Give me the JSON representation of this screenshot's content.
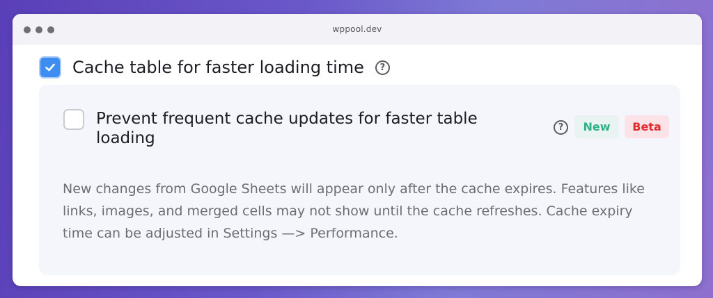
{
  "window": {
    "url": "wppool.dev"
  },
  "main_option": {
    "label": "Cache table for faster loading time",
    "checked": true,
    "help_icon": "question-circle-icon"
  },
  "sub_option": {
    "label": "Prevent frequent cache updates for faster table loading",
    "checked": false,
    "help_icon": "question-circle-icon",
    "badges": {
      "new": "New",
      "beta": "Beta"
    },
    "description": "New changes from Google Sheets will appear only after the cache expires. Features like links, images, and merged cells may not show until the cache refreshes. Cache expiry time can be adjusted in Settings —> Performance."
  },
  "colors": {
    "accent": "#3d8ef0",
    "new_badge_text": "#32b087",
    "beta_badge_text": "#e12a2f"
  }
}
